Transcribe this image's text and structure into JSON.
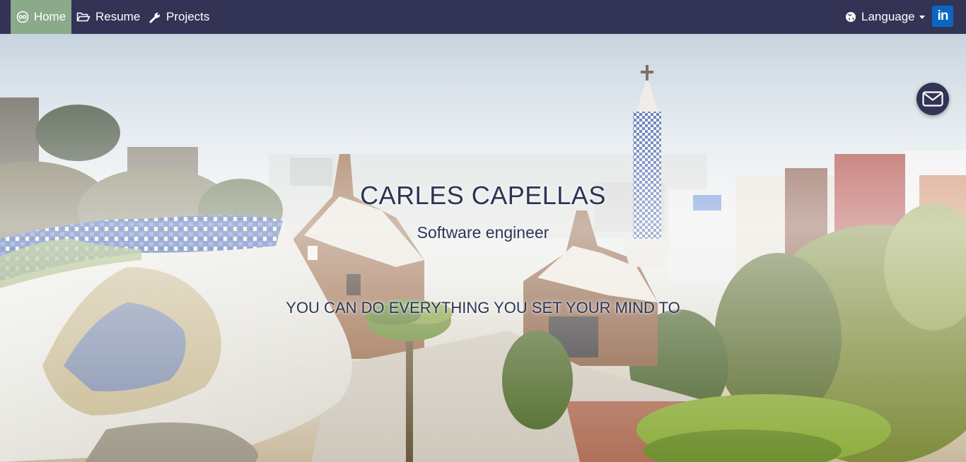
{
  "nav": {
    "home": "Home",
    "resume": "Resume",
    "projects": "Projects",
    "language": "Language",
    "linkedin": "in"
  },
  "hero": {
    "name": "CARLES CAPELLAS",
    "role": "Software engineer",
    "motto": "YOU CAN DO EVERYTHING YOU SET YOUR MIND TO"
  },
  "colors": {
    "navbar": "#333355",
    "active_tab": "#8aaa8a",
    "title_text": "#2c3555",
    "linkedin": "#0a66c2"
  },
  "icons": {
    "home": "home-icon",
    "resume": "folder-open-icon",
    "projects": "wrench-icon",
    "language": "globe-icon",
    "mail": "envelope-icon"
  }
}
